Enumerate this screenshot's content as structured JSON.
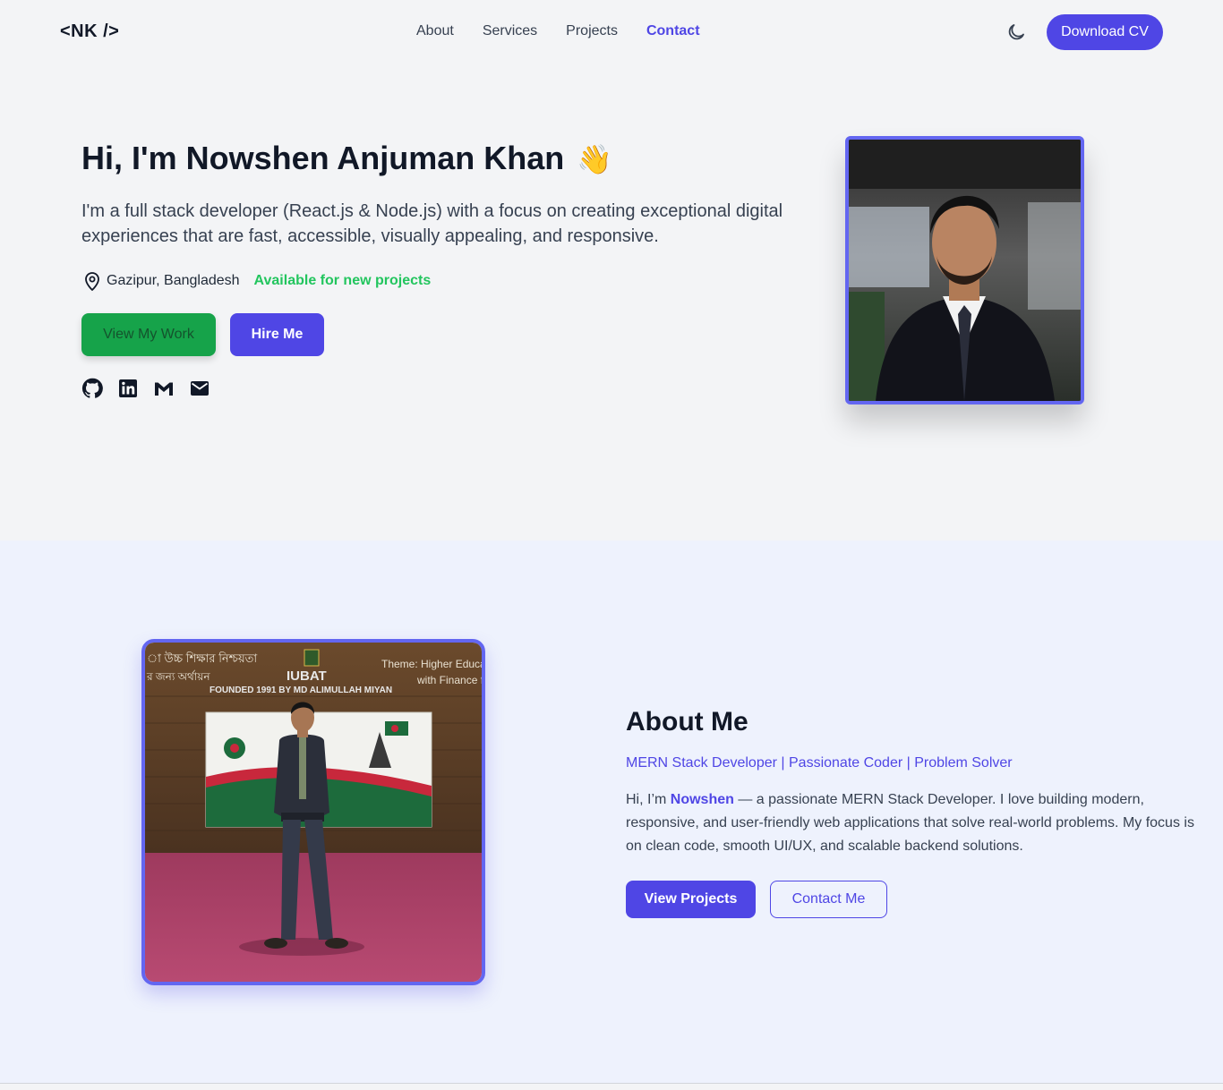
{
  "header": {
    "logo": "<NK />",
    "nav": [
      "About",
      "Services",
      "Projects",
      "Contact"
    ],
    "active_nav": "Contact",
    "download_cv": "Download CV",
    "theme_icon": "moon-icon"
  },
  "hero": {
    "title": "Hi, I'm Nowshen Anjuman Khan",
    "wave_emoji": "👋",
    "description": "I'm a full stack developer (React.js & Node.js) with a focus on creating exceptional digital experiences that are fast, accessible, visually appealing, and responsive.",
    "location": "Gazipur, Bangladesh",
    "availability": "Available for new projects",
    "view_work": "View My Work",
    "hire_me": "Hire Me",
    "socials": [
      "github-icon",
      "linkedin-icon",
      "gmail-icon",
      "mail-icon"
    ]
  },
  "about": {
    "title": "About Me",
    "subtitle": "MERN Stack Developer | Passionate Coder | Problem Solver",
    "text_prefix": "Hi, I’m ",
    "name": "Nowshen",
    "text_suffix": " — a passionate MERN Stack Developer. I love building modern, responsive, and user-friendly web applications that solve real-world problems. My focus is on clean code, smooth UI/UX, and scalable backend solutions.",
    "view_projects": "View Projects",
    "contact_me": "Contact Me",
    "photo_banner": {
      "line1": "IUBAT",
      "line2": "FOUNDED 1991 BY MD ALIMULLAH MIYAN",
      "theme1": "Theme: Higher Educati",
      "theme2": "with Finance fo",
      "bangla1": "া উচ্চ শিক্ষার নিশ্চয়তা",
      "bangla2": "র জন্য অর্থায়ন"
    }
  },
  "colors": {
    "accent": "#4f46e5",
    "green": "#16a34a",
    "available": "#22c55e"
  }
}
